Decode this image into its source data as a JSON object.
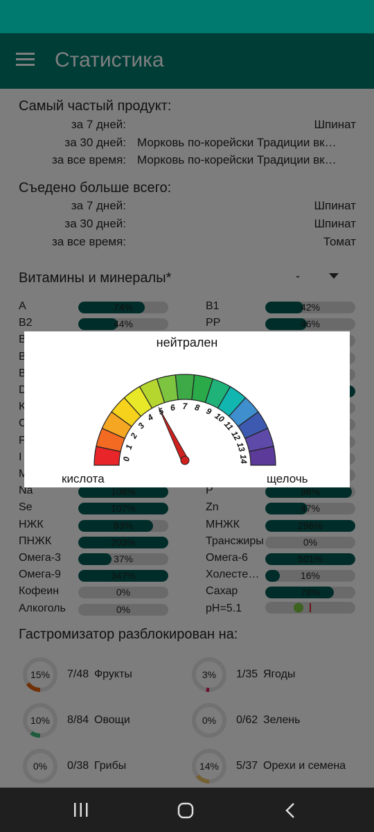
{
  "app": {
    "title": "Статистика"
  },
  "frequent": {
    "title": "Самый частый продукт:",
    "rows": [
      {
        "label": "за 7 дней:",
        "value": "Шпинат"
      },
      {
        "label": "за 30 дней:",
        "value": "Морковь по-корейски Традиции вк…"
      },
      {
        "label": "за все время:",
        "value": "Морковь по-корейски Традиции вк…"
      }
    ]
  },
  "eaten": {
    "title": "Съедено больше всего:",
    "rows": [
      {
        "label": "за 7 дней:",
        "value": "Шпинат"
      },
      {
        "label": "за 30 дней:",
        "value": "Шпинат"
      },
      {
        "label": "за все время:",
        "value": "Томат"
      }
    ]
  },
  "vitamins": {
    "title": "Витамины и минералы*",
    "selector_value": "-",
    "rows": [
      {
        "left": {
          "name": "A",
          "text": "74%",
          "fill": 0.74
        },
        "right": {
          "name": "B1",
          "text": "42%",
          "fill": 0.42
        }
      },
      {
        "left": {
          "name": "B2",
          "text": "44%",
          "fill": 0.44
        },
        "right": {
          "name": "PP",
          "text": "46%",
          "fill": 0.46
        }
      },
      {
        "left": {
          "name": "B",
          "text": "",
          "fill": 0
        },
        "right": {
          "name": "",
          "text": "",
          "fill": 0
        }
      },
      {
        "left": {
          "name": "B",
          "text": "",
          "fill": 0
        },
        "right": {
          "name": "",
          "text": "",
          "fill": 0
        }
      },
      {
        "left": {
          "name": "B",
          "text": "",
          "fill": 0
        },
        "right": {
          "name": "",
          "text": "",
          "fill": 0
        }
      },
      {
        "left": {
          "name": "D",
          "text": "",
          "fill": 0
        },
        "right": {
          "name": "",
          "text": "",
          "fill": 1
        }
      },
      {
        "left": {
          "name": "K",
          "text": "",
          "fill": 0
        },
        "right": {
          "name": "",
          "text": "",
          "fill": 0
        }
      },
      {
        "left": {
          "name": "C",
          "text": "",
          "fill": 0
        },
        "right": {
          "name": "",
          "text": "",
          "fill": 0
        }
      },
      {
        "left": {
          "name": "F",
          "text": "",
          "fill": 0
        },
        "right": {
          "name": "",
          "text": "",
          "fill": 0
        }
      },
      {
        "left": {
          "name": "I",
          "text": "",
          "fill": 0
        },
        "right": {
          "name": "",
          "text": "",
          "fill": 0
        }
      },
      {
        "left": {
          "name": "M",
          "text": "",
          "fill": 0
        },
        "right": {
          "name": "",
          "text": "",
          "fill": 0
        }
      },
      {
        "left": {
          "name": "Na",
          "text": "108%",
          "fill": 1
        },
        "right": {
          "name": "P",
          "text": "96%",
          "fill": 0.96
        }
      },
      {
        "left": {
          "name": "Se",
          "text": "107%",
          "fill": 1
        },
        "right": {
          "name": "Zn",
          "text": "47%",
          "fill": 0.47
        }
      },
      {
        "left": {
          "name": "НЖК",
          "text": "83%",
          "fill": 0.83
        },
        "right": {
          "name": "МНЖК",
          "text": "296%",
          "fill": 1
        }
      },
      {
        "left": {
          "name": "ПНЖК",
          "text": "203%",
          "fill": 1
        },
        "right": {
          "name": "Трансжиры",
          "text": "0%",
          "fill": 0
        }
      },
      {
        "left": {
          "name": "Омега-3",
          "text": "37%",
          "fill": 0.37
        },
        "right": {
          "name": "Омега-6",
          "text": "501%",
          "fill": 1
        }
      },
      {
        "left": {
          "name": "Омега-9",
          "text": "347%",
          "fill": 1
        },
        "right": {
          "name": "Холестерин",
          "text": "16%",
          "fill": 0.16
        }
      },
      {
        "left": {
          "name": "Кофеин",
          "text": "0%",
          "fill": 0
        },
        "right": {
          "name": "Сахар",
          "text": "76%",
          "fill": 0.76
        }
      },
      {
        "left": {
          "name": "Алкоголь",
          "text": "0%",
          "fill": 0
        },
        "right": {
          "name": "pH=5.1",
          "text": "",
          "fill": 0
        }
      }
    ],
    "ph_value": 5.1
  },
  "gastro": {
    "title": "Гастромизатор разблокирован на:",
    "items": [
      {
        "percent": "15%",
        "fraction": 0.15,
        "count": "7/48",
        "name": "Фрукты",
        "color": "#e06010"
      },
      {
        "percent": "3%",
        "fraction": 0.03,
        "count": "1/35",
        "name": "Ягоды",
        "color": "#d81b60"
      },
      {
        "percent": "10%",
        "fraction": 0.1,
        "count": "8/84",
        "name": "Овощи",
        "color": "#3cb878"
      },
      {
        "percent": "0%",
        "fraction": 0,
        "count": "0/62",
        "name": "Зелень",
        "color": "#4caf50"
      },
      {
        "percent": "0%",
        "fraction": 0,
        "count": "0/38",
        "name": "Грибы",
        "color": "#8d6e63"
      },
      {
        "percent": "14%",
        "fraction": 0.14,
        "count": "5/37",
        "name": "Орехи и семена",
        "color": "#e8c060"
      }
    ]
  },
  "ph_dialog": {
    "neutral_label": "нейтрален",
    "acid_label": "кислота",
    "alkali_label": "щелочь",
    "scale": [
      "0",
      "1",
      "2",
      "3",
      "4",
      "5",
      "6",
      "7",
      "8",
      "9",
      "10",
      "11",
      "12",
      "13",
      "14"
    ],
    "segment_colors": [
      "#e8262a",
      "#f36a22",
      "#f5a623",
      "#f7d21c",
      "#e8e829",
      "#b5d62f",
      "#7dc441",
      "#3daa47",
      "#2aaa48",
      "#1fb37a",
      "#12b6b0",
      "#3f8fcf",
      "#3d5ab0",
      "#5e4aa8",
      "#5b3a9a"
    ],
    "needle_value": 5.1,
    "needle_color": "#d0201e"
  },
  "navbar": {
    "recent_icon": "recent-apps-icon",
    "home_icon": "home-icon",
    "back_icon": "back-icon"
  }
}
